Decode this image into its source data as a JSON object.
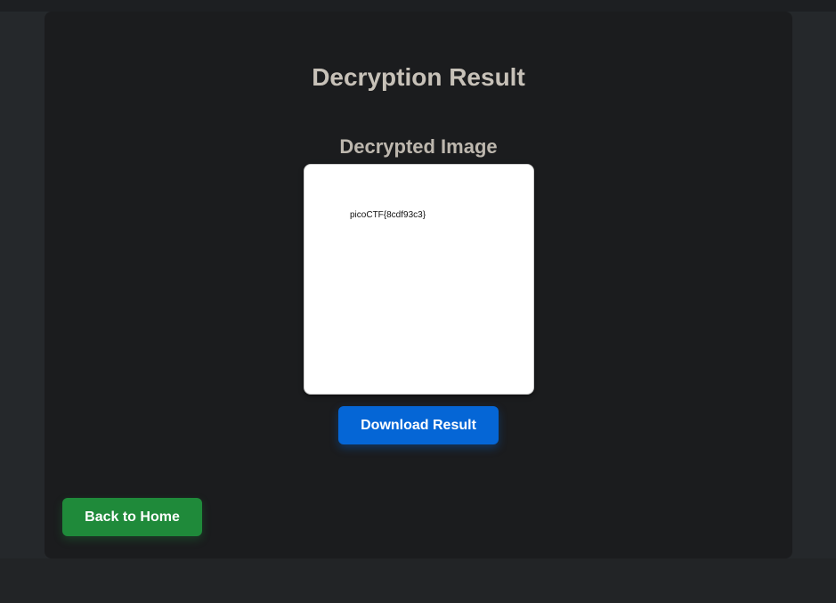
{
  "page": {
    "title": "Decryption Result",
    "section_title": "Decrypted Image"
  },
  "image": {
    "flag_text": "picoCTF{8cdf93c3}"
  },
  "buttons": {
    "download_label": "Download Result",
    "back_home_label": "Back to Home"
  },
  "colors": {
    "background": "#1f2124",
    "card": "#1b1c1e",
    "title_text": "#c7c1b8",
    "primary_button": "#0566d6",
    "success_button": "#1f8a3a"
  }
}
